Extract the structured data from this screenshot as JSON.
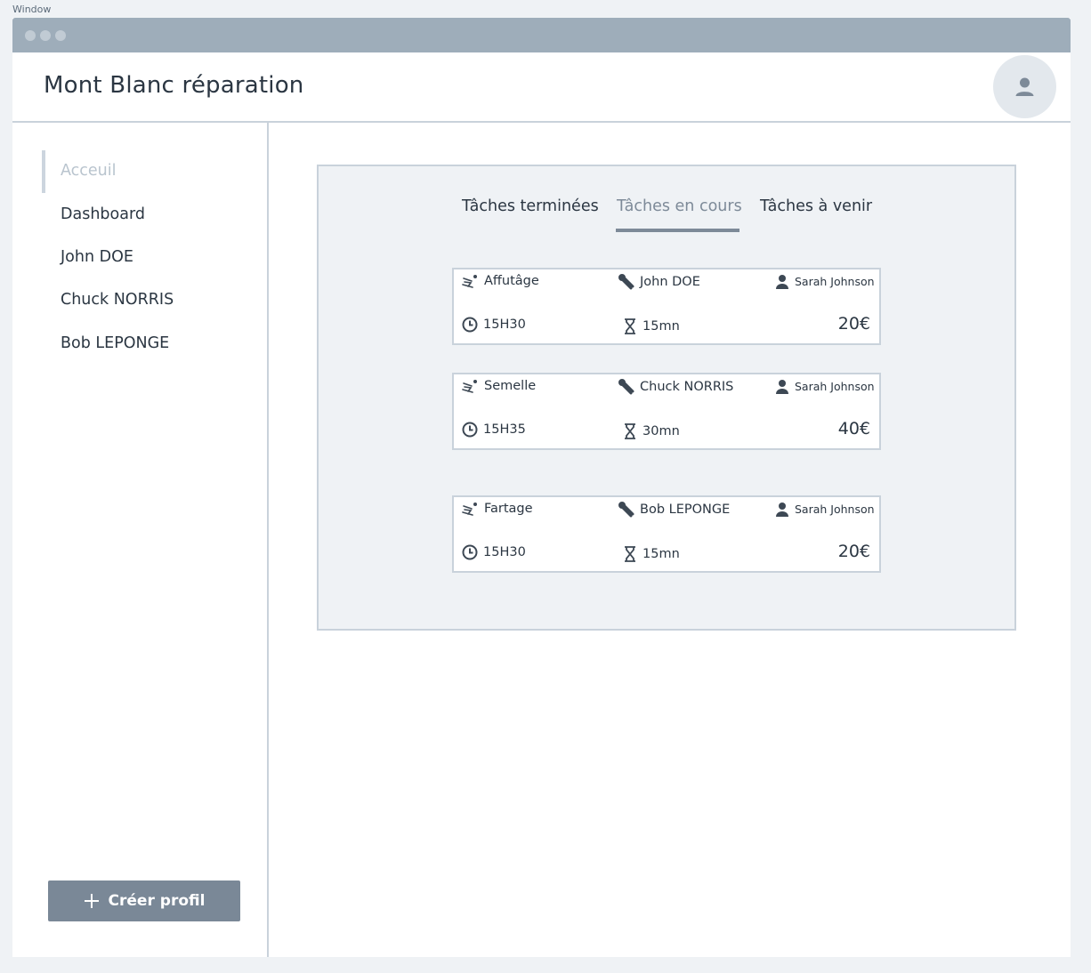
{
  "window": {
    "label": "Window"
  },
  "app": {
    "title": "Mont Blanc réparation"
  },
  "sidebar": {
    "items": [
      {
        "label": "Acceuil"
      },
      {
        "label": "Dashboard"
      },
      {
        "label": "John DOE"
      },
      {
        "label": "Chuck NORRIS"
      },
      {
        "label": "Bob LEPONGE"
      }
    ],
    "active_index": 0,
    "create_button": "Créer profil"
  },
  "tabs": [
    {
      "label": "Tâches terminées"
    },
    {
      "label": "Tâches en cours"
    },
    {
      "label": "Tâches à venir"
    }
  ],
  "active_tab": 1,
  "tasks": [
    {
      "service": "Affutâge",
      "technician": "John DOE",
      "client": "Sarah Johnson",
      "time": "15H30",
      "duration": "15mn",
      "price": "20€"
    },
    {
      "service": "Semelle",
      "technician": "Chuck NORRIS",
      "client": "Sarah Johnson",
      "time": "15H35",
      "duration": "30mn",
      "price": "40€"
    },
    {
      "service": "Fartage",
      "technician": "Bob LEPONGE",
      "client": "Sarah Johnson",
      "time": "15H30",
      "duration": "15mn",
      "price": "20€"
    }
  ],
  "colors": {
    "titlebar": "#9eadba",
    "accent": "#7d8a98",
    "button": "#7a8897",
    "border": "#c9d2db",
    "panel": "#eff2f5"
  },
  "icons": {
    "service": "skier-icon",
    "technician": "tools-icon",
    "client": "user-icon",
    "time": "clock-icon",
    "duration": "hourglass-icon",
    "create": "plus-icon",
    "avatar": "user-icon"
  }
}
